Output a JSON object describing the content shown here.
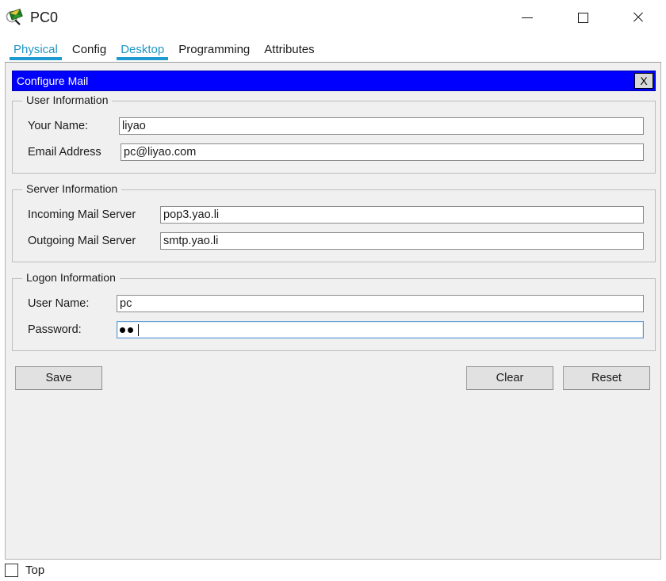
{
  "window": {
    "title": "PC0",
    "icon": "packet-tracer-pc-icon",
    "controls": {
      "minimize": "minimize-icon",
      "maximize": "maximize-icon",
      "close": "close-icon"
    }
  },
  "tabs": [
    {
      "label": "Physical",
      "active": true
    },
    {
      "label": "Config",
      "active": false
    },
    {
      "label": "Desktop",
      "active": true
    },
    {
      "label": "Programming",
      "active": false
    },
    {
      "label": "Attributes",
      "active": false
    }
  ],
  "dialog": {
    "title": "Configure Mail",
    "close_label": "X",
    "title_bg": "#0000fe",
    "title_fg": "#ffffff",
    "groups": {
      "user": {
        "legend": "User Information",
        "fields": [
          {
            "label": "Your Name:",
            "value": "liyao"
          },
          {
            "label": "Email Address",
            "value": "pc@liyao.com"
          }
        ]
      },
      "server": {
        "legend": "Server Information",
        "fields": [
          {
            "label": "Incoming Mail Server",
            "value": "pop3.yao.li"
          },
          {
            "label": "Outgoing Mail Server",
            "value": "smtp.yao.li"
          }
        ]
      },
      "logon": {
        "legend": "Logon Information",
        "fields": [
          {
            "label": "User Name:",
            "value": "pc"
          },
          {
            "label": "Password:",
            "value": "••",
            "masked": true,
            "focused": true,
            "mask_count": 2
          }
        ]
      }
    },
    "buttons": {
      "save": "Save",
      "clear": "Clear",
      "reset": "Reset"
    }
  },
  "statusbar": {
    "checkbox_label": "Top",
    "checked": false
  },
  "colors": {
    "accent": "#1e9ad1",
    "dialog_title": "#0000fe",
    "panel_bg": "#f0f0f0",
    "button_bg": "#e1e1e1",
    "field_focus": "#5a9bd5"
  }
}
